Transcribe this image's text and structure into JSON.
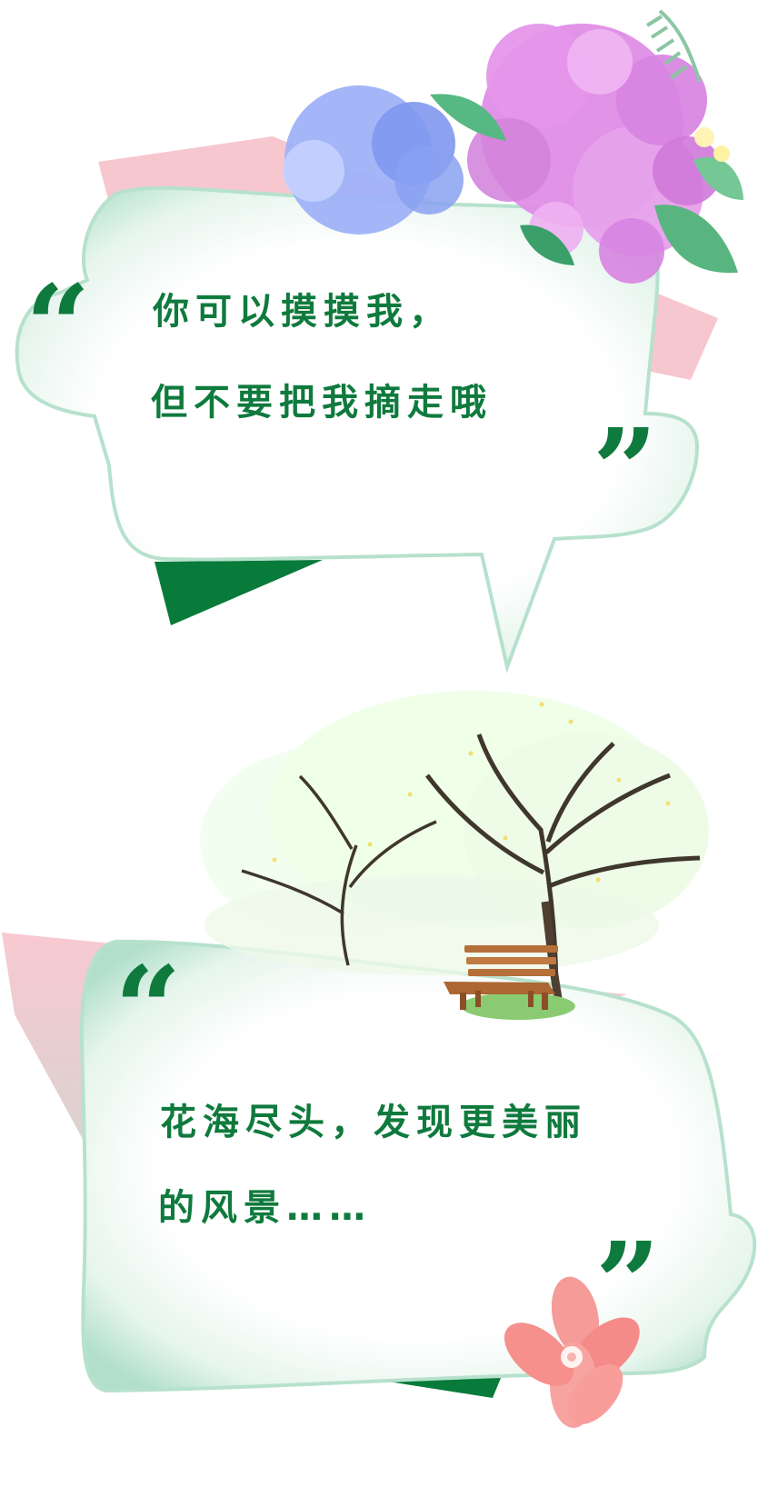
{
  "bubble_top": {
    "line1": "你可以摸摸我，",
    "line2": "但不要把我摘走哦",
    "open_quote": "“",
    "close_quote": "”"
  },
  "bubble_bottom": {
    "line1": "花海尽头，发现更美丽",
    "line2": "的风景……",
    "open_quote": "“",
    "close_quote": "”"
  },
  "colors": {
    "text_green": "#0f7a3d",
    "dark_green": "#087a3a",
    "pink_bg": "#f7c8d0",
    "mint": "#a9dcc2",
    "hydrangea_pink": "#df8fe6",
    "hydrangea_blue": "#8ea3f2",
    "petal_pink": "#f48b88"
  },
  "icons": {
    "hydrangea": "hydrangea-flower-icon",
    "blossom_tree": "blossom-tree-icon",
    "bench": "bench-icon",
    "pink_flower": "pink-flower-icon"
  }
}
